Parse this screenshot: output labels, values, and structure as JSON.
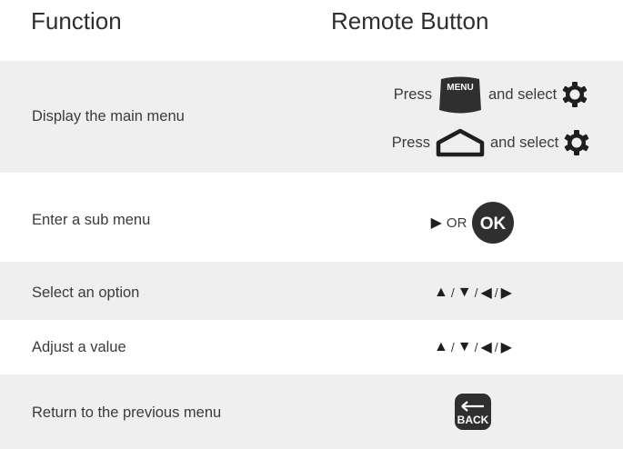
{
  "header": {
    "function": "Function",
    "remote_button": "Remote Button"
  },
  "rows": [
    {
      "function": "Display the main menu",
      "lines": [
        {
          "pre": "Press",
          "button": "MENU",
          "post": "and select",
          "icon": "gear-icon"
        },
        {
          "pre": "Press",
          "icon1": "home-icon",
          "post": "and select",
          "icon": "gear-icon"
        }
      ]
    },
    {
      "function": "Enter a sub menu",
      "arrow": "▶",
      "or": "OR",
      "button": "OK"
    },
    {
      "function": "Select an option",
      "arrows": [
        "▲",
        "▼",
        "◀",
        "▶"
      ],
      "separator": "/"
    },
    {
      "function": "Adjust a value",
      "arrows": [
        "▲",
        "▼",
        "◀",
        "▶"
      ],
      "separator": "/"
    },
    {
      "function": "Return to the previous menu",
      "button": "BACK"
    }
  ],
  "colors": {
    "row_shade": "#efefef",
    "button_fill": "#2f2f2f"
  }
}
